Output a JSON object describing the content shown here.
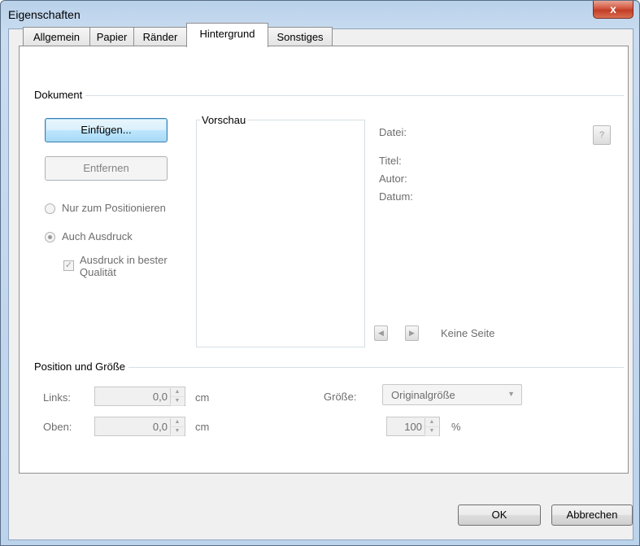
{
  "window": {
    "title": "Eigenschaften",
    "close_label": "x"
  },
  "tabs": [
    {
      "label": "Allgemein"
    },
    {
      "label": "Papier"
    },
    {
      "label": "Ränder"
    },
    {
      "label": "Hintergrund",
      "active": true
    },
    {
      "label": "Sonstiges"
    }
  ],
  "dokument": {
    "group_label": "Dokument",
    "insert_button": "Einfügen...",
    "remove_button": "Entfernen",
    "radio_position": "Nur zum Positionieren",
    "radio_print": "Auch Ausdruck",
    "checkbox_quality_line1": "Ausdruck in bester",
    "checkbox_quality_line2": "Qualität",
    "preview_label": "Vorschau",
    "info_file": "Datei:",
    "info_title": "Titel:",
    "info_author": "Autor:",
    "info_date": "Datum:",
    "page_status": "Keine Seite"
  },
  "position": {
    "group_label": "Position und Größe",
    "left_label": "Links:",
    "left_value": "0,0",
    "top_label": "Oben:",
    "top_value": "0,0",
    "unit_cm_1": "cm",
    "unit_cm_2": "cm",
    "size_label": "Größe:",
    "size_select": "Originalgröße",
    "percent_value": "100",
    "percent_unit": "%"
  },
  "footer": {
    "ok": "OK",
    "cancel": "Abbrechen"
  }
}
